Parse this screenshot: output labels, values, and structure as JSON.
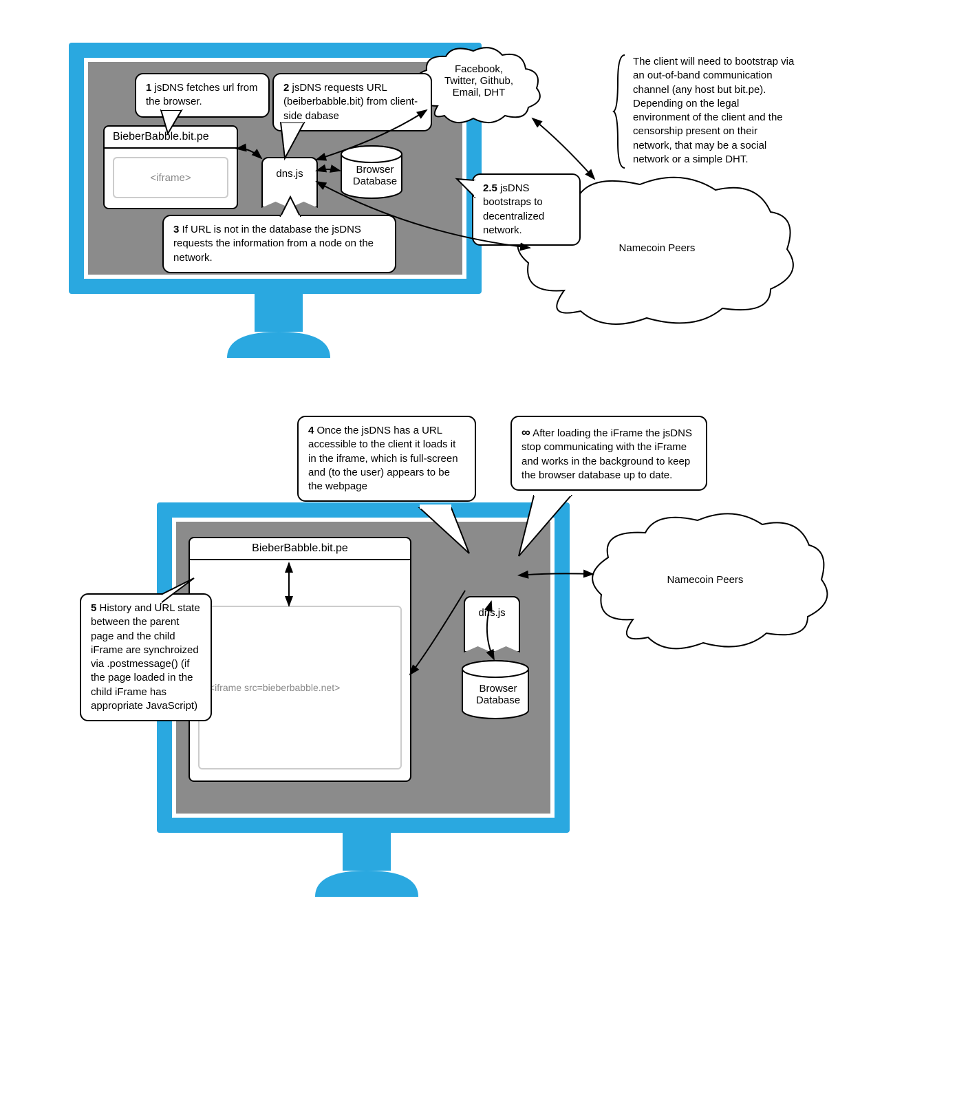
{
  "diagram1": {
    "callout1": {
      "num": "1",
      "text": " jsDNS fetches url from the browser."
    },
    "callout2": {
      "num": "2",
      "text": " jsDNS requests URL (beiberbabble.bit) from client-side dabase"
    },
    "callout25": {
      "num": "2.5",
      "text": " jsDNS bootstraps to decentralized network."
    },
    "callout3": {
      "num": "3",
      "text": " If URL is not in the database the jsDNS requests the information from a node on the network."
    },
    "browser_title": "BieberBabble.bit.pe",
    "iframe_label": "<iframe>",
    "dnsjs_label": "dns.js",
    "db_label_line1": "Browser",
    "db_label_line2": "Database",
    "cloud_social_lines": [
      "Facebook,",
      "Twitter, Github,",
      "Email, DHT"
    ],
    "cloud_peers": "Namecoin Peers",
    "side_note": "The client will need to bootstrap via an out-of-band communication channel (any host but bit.pe).  Depending on the legal  environment of the client and the censorship present on their network, that may be a social network or a simple DHT."
  },
  "diagram2": {
    "callout4": {
      "num": "4",
      "text": " Once the jsDNS has a URL accessible to the client it loads it in the iframe, which is full-screen and (to the user) appears to be the webpage"
    },
    "callout5": {
      "num": "5",
      "text": " History and URL state between the parent page and the child iFrame are synchroized via .postmessage() (if the page loaded in the child iFrame has appropriate JavaScript)"
    },
    "callout_inf": {
      "num": "∞",
      "text": " After loading the iFrame the jsDNS stop communicating with the iFrame and works in the background to keep the browser database up to date."
    },
    "browser_title": "BieberBabble.bit.pe",
    "iframe_label": "<iframe src=bieberbabble.net>",
    "dnsjs_label": "dns.js",
    "db_label_line1": "Browser",
    "db_label_line2": "Database",
    "cloud_peers": "Namecoin Peers"
  },
  "colors": {
    "monitor_blue": "#2aa8e0",
    "screen_gray": "#8b8b8b"
  }
}
